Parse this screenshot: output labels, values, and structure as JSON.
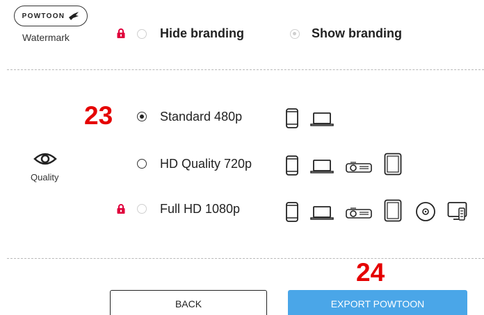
{
  "watermark": {
    "logo_text": "POWTOON",
    "label": "Watermark",
    "options": [
      {
        "label": "Hide branding",
        "locked": true,
        "selected": false
      },
      {
        "label": "Show branding",
        "locked": false,
        "selected": true
      }
    ]
  },
  "quality": {
    "label": "Quality",
    "step_number": "23",
    "options": [
      {
        "label": "Standard 480p",
        "selected": true,
        "locked": false,
        "devices": [
          "phone-icon",
          "laptop-icon"
        ]
      },
      {
        "label": "HD Quality 720p",
        "selected": false,
        "locked": false,
        "devices": [
          "phone-icon",
          "laptop-icon",
          "projector-icon",
          "tablet-icon"
        ]
      },
      {
        "label": "Full HD 1080p",
        "selected": false,
        "locked": true,
        "devices": [
          "phone-icon",
          "laptop-icon",
          "projector-icon",
          "tablet-icon",
          "disc-icon",
          "tv-remote-icon"
        ]
      }
    ]
  },
  "actions": {
    "step_number": "24",
    "back_label": "BACK",
    "export_label": "EXPORT POWTOON"
  },
  "colors": {
    "lock": "#e0003c",
    "step_number": "#e50000",
    "export_button": "#4aa6e8",
    "divider": "#b8b8b8"
  }
}
